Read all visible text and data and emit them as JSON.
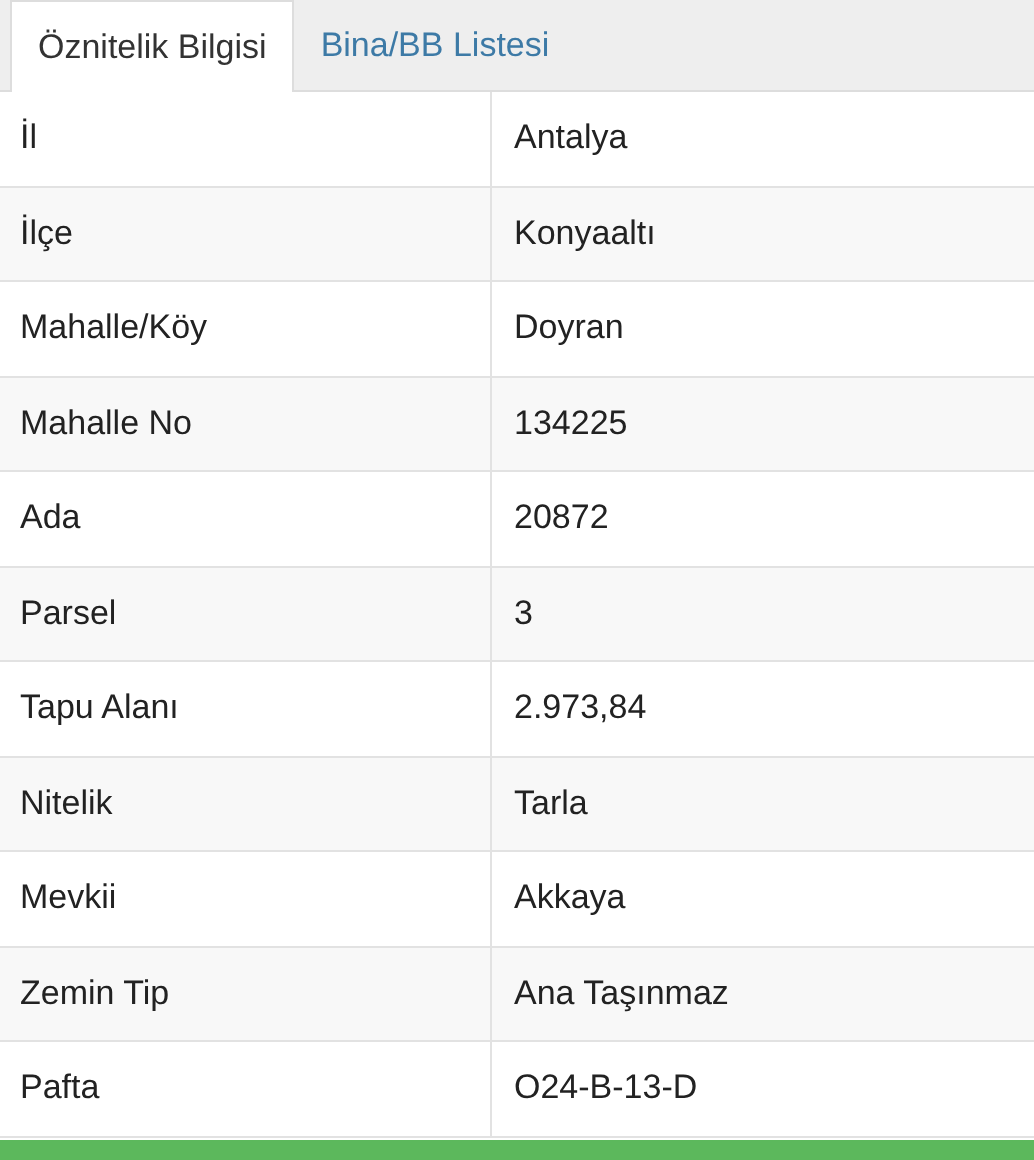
{
  "tabs": [
    {
      "label": "Öznitelik Bilgisi",
      "selected": true
    },
    {
      "label": "Bina/BB Listesi",
      "selected": false
    }
  ],
  "table": {
    "rows": [
      {
        "label": "İl",
        "value": "Antalya"
      },
      {
        "label": "İlçe",
        "value": "Konyaaltı"
      },
      {
        "label": "Mahalle/Köy",
        "value": "Doyran"
      },
      {
        "label": "Mahalle No",
        "value": "134225"
      },
      {
        "label": "Ada",
        "value": "20872"
      },
      {
        "label": "Parsel",
        "value": "3"
      },
      {
        "label": "Tapu Alanı",
        "value": "2.973,84"
      },
      {
        "label": "Nitelik",
        "value": "Tarla"
      },
      {
        "label": "Mevkii",
        "value": "Akkaya"
      },
      {
        "label": "Zemin Tip",
        "value": "Ana Taşınmaz"
      },
      {
        "label": "Pafta",
        "value": "O24-B-13-D"
      }
    ]
  }
}
